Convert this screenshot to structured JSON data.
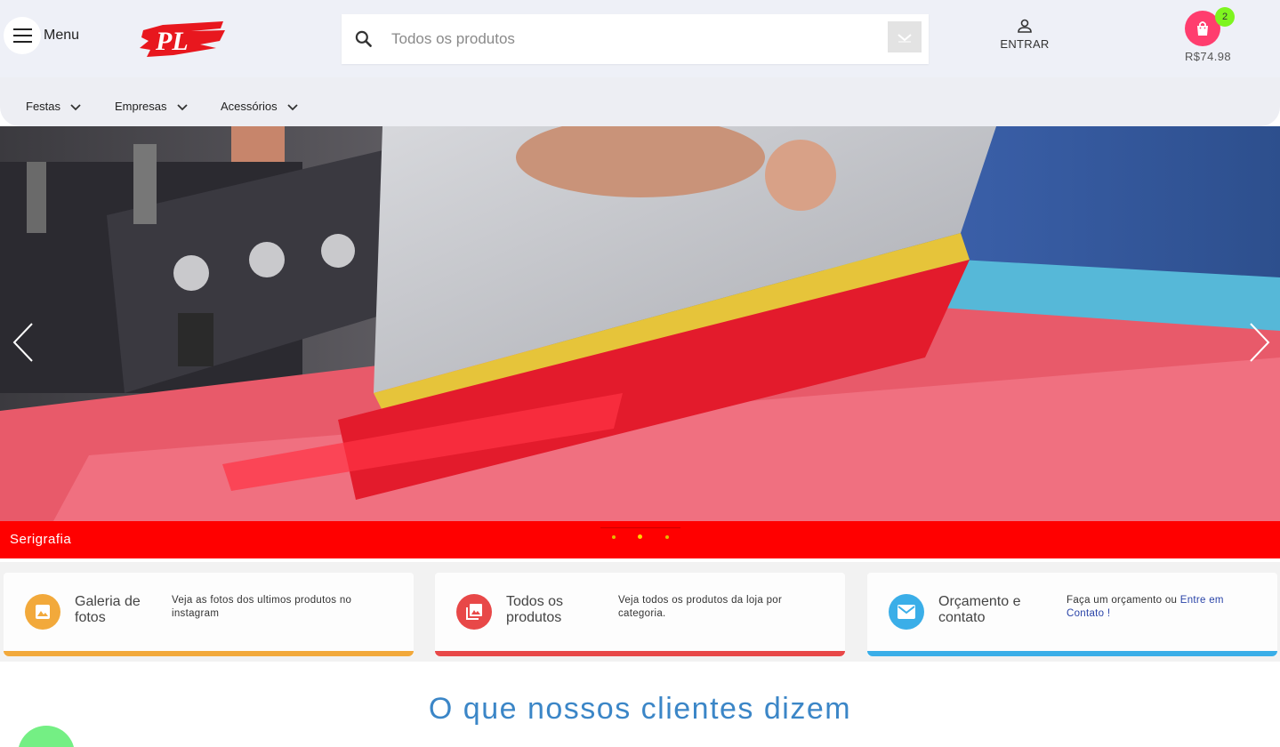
{
  "header": {
    "menu_label": "Menu",
    "logo_text": "PL",
    "search_placeholder": "Todos os produtos",
    "login_label": "ENTRAR",
    "cart_count": "2",
    "cart_total": "R$74.98"
  },
  "categories": [
    {
      "label": "Festas"
    },
    {
      "label": "Empresas"
    },
    {
      "label": "Acessórios"
    }
  ],
  "banner": {
    "caption": "Serigrafia",
    "slide_count": 3,
    "active_slide": 2
  },
  "features": [
    {
      "title": "Galeria de fotos",
      "description": "Veja as fotos dos ultimos produtos no instagram",
      "color": "#f2a93b"
    },
    {
      "title": "Todos os produtos",
      "description": "Veja todos os produtos da loja por categoria.",
      "color": "#e84848"
    },
    {
      "title": "Orçamento e contato",
      "description": "Faça um orçamento ou ",
      "link": "Entre em Contato !",
      "color": "#3aaee8"
    }
  ],
  "testimonials_heading": "O que nossos clientes dizem",
  "colors": {
    "accent_red": "#ff0000",
    "cart_pink": "#ff3d6e",
    "badge_green": "#7ef51f",
    "heading_blue": "#3b86c7"
  }
}
